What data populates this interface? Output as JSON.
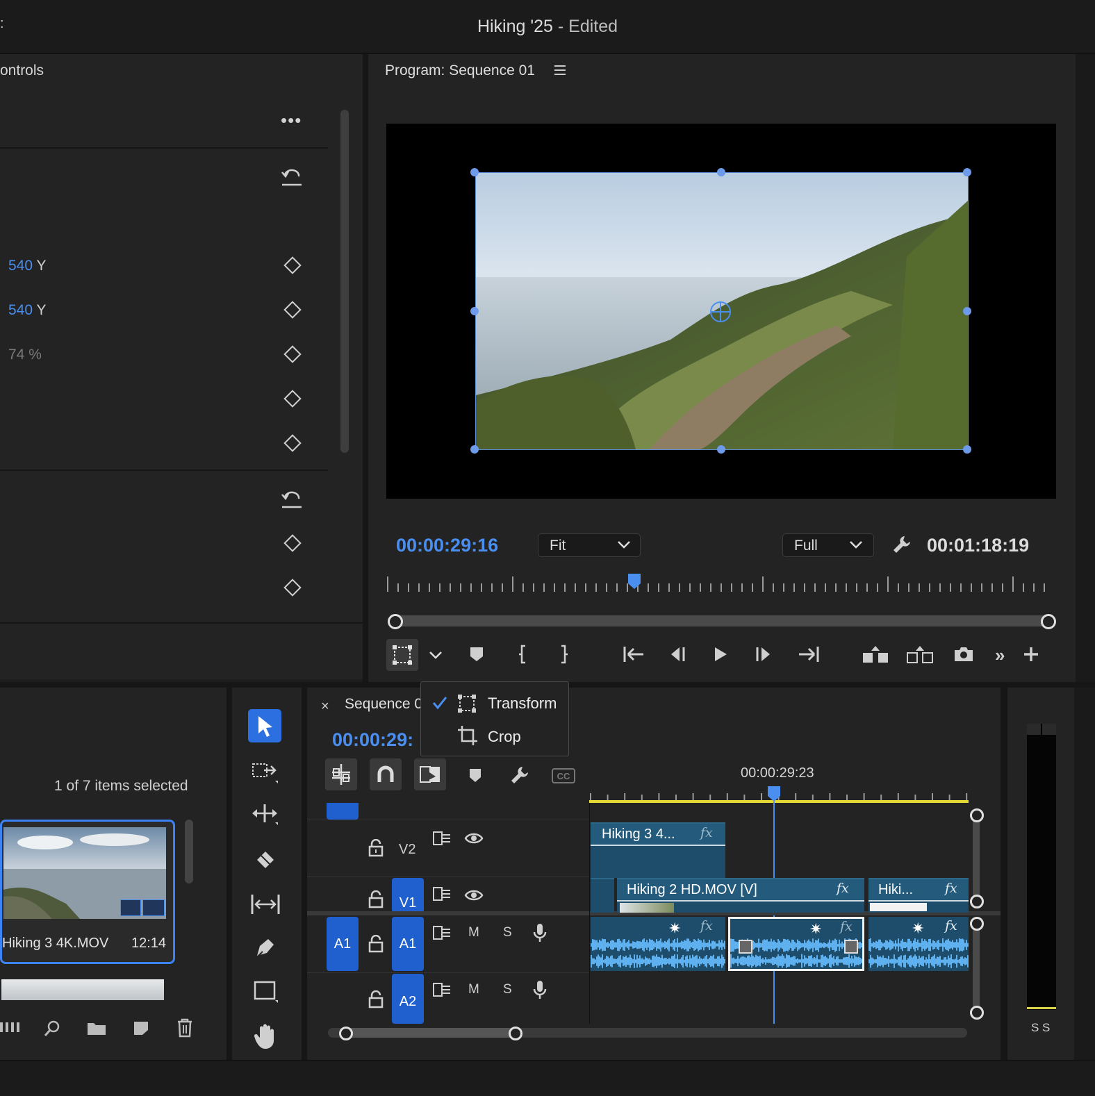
{
  "window": {
    "title": "Hiking '25",
    "status": "- Edited"
  },
  "effect_controls": {
    "tab_label": "ontrols",
    "rows": [
      {
        "value": "540",
        "axis": "Y"
      },
      {
        "value": "540",
        "axis": "Y"
      },
      {
        "value": "74 %"
      }
    ]
  },
  "program_monitor": {
    "title": "Program: Sequence 01",
    "current_time": "00:00:29:16",
    "zoom_select": "Fit",
    "resolution_select": "Full",
    "duration": "00:01:18:19"
  },
  "overlay_menu": {
    "items": [
      {
        "label": "Transform",
        "checked": true
      },
      {
        "label": "Crop",
        "checked": false
      }
    ]
  },
  "project": {
    "selection_status": "1 of 7 items selected",
    "clip": {
      "name": "Hiking 3 4K.MOV",
      "duration": "12:14"
    }
  },
  "timeline": {
    "tab_label": "Sequence 0",
    "timecode": "00:00:29:",
    "ruler_time": "00:00:29:23",
    "tracks": {
      "v2": "V2",
      "v1": "V1",
      "a1_source": "A1",
      "a1": "A1",
      "a2": "A2",
      "mute": "M",
      "solo": "S"
    },
    "clips": {
      "v2_clip": "Hiking 3 4...",
      "v1_clip": "Hiking 2 HD.MOV [V]",
      "v1_clip_short": "Hiki..."
    },
    "fx_label": "fx"
  },
  "audio_meter": {
    "labels": "S S"
  },
  "colors": {
    "accent": "#4a8ff0",
    "track_blue": "#1f5fce",
    "clip": "#1e4d6b",
    "wave": "#5fb0ef"
  }
}
